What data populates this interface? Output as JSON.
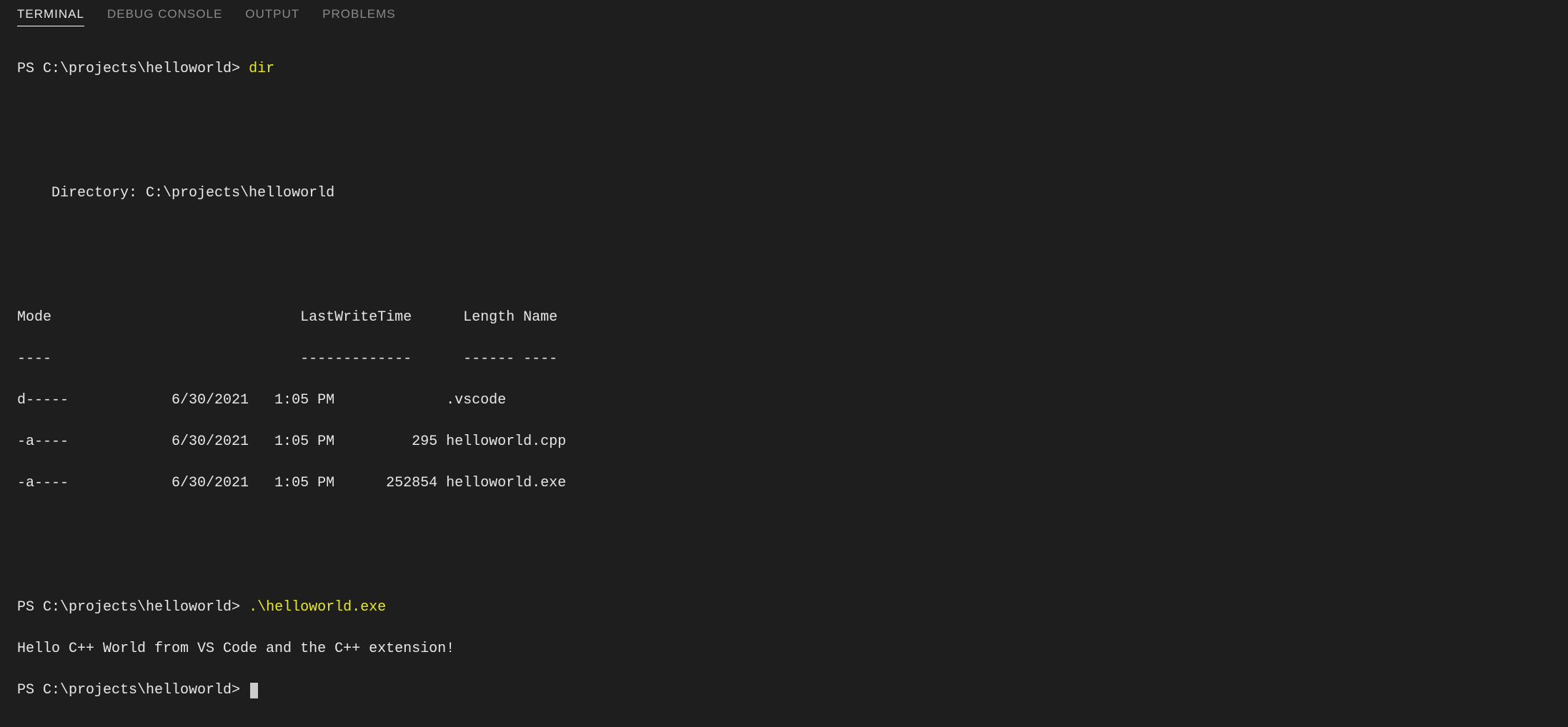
{
  "tabs": {
    "items": [
      {
        "label": "TERMINAL",
        "active": true
      },
      {
        "label": "DEBUG CONSOLE",
        "active": false
      },
      {
        "label": "OUTPUT",
        "active": false
      },
      {
        "label": "PROBLEMS",
        "active": false
      }
    ]
  },
  "terminal": {
    "prompt1": "PS C:\\projects\\helloworld> ",
    "command1": "dir",
    "dir_header": "    Directory: C:\\projects\\helloworld",
    "table": {
      "headers": {
        "mode": "Mode",
        "lwt": "LastWriteTime",
        "length": "Length",
        "name": "Name"
      },
      "dividers": {
        "mode": "----",
        "lwt": "-------------",
        "length": "------",
        "name": "----"
      },
      "rows": [
        {
          "mode": "d-----",
          "date": "6/30/2021",
          "time": "1:05 PM",
          "length": "",
          "name": ".vscode"
        },
        {
          "mode": "-a----",
          "date": "6/30/2021",
          "time": "1:05 PM",
          "length": "295",
          "name": "helloworld.cpp"
        },
        {
          "mode": "-a----",
          "date": "6/30/2021",
          "time": "1:05 PM",
          "length": "252854",
          "name": "helloworld.exe"
        }
      ]
    },
    "prompt2": "PS C:\\projects\\helloworld> ",
    "command2": ".\\helloworld.exe",
    "output2": "Hello C++ World from VS Code and the C++ extension!",
    "prompt3": "PS C:\\projects\\helloworld> "
  }
}
